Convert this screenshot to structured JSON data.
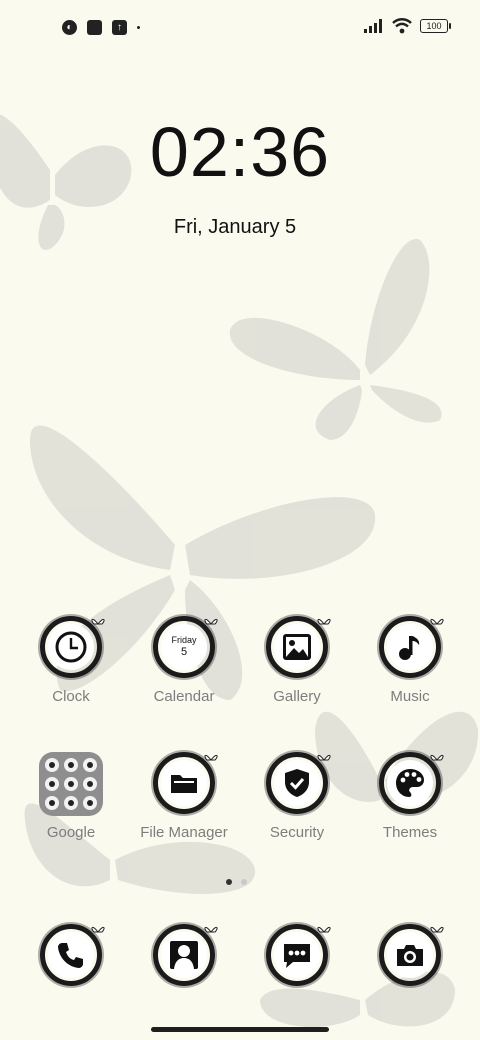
{
  "status_bar": {
    "battery": "100",
    "left_icons": [
      "theme-icon",
      "square-notification-icon",
      "upload-icon",
      "dot-icon"
    ],
    "right_icons": [
      "signal-icon",
      "wifi-icon",
      "battery-icon"
    ]
  },
  "lockscreen": {
    "time": "02:36",
    "date": "Fri, January 5"
  },
  "calendar_icon": {
    "day": "Friday",
    "num": "5"
  },
  "apps": {
    "clock": "Clock",
    "calendar": "Calendar",
    "gallery": "Gallery",
    "music": "Music",
    "google": "Google",
    "file_manager": "File Manager",
    "security": "Security",
    "themes": "Themes"
  },
  "dock_icons": [
    "phone-icon",
    "contacts-icon",
    "messages-icon",
    "camera-icon"
  ],
  "colors": {
    "background": "#fbfaef",
    "icon_ring": "#1b1b1b",
    "label": "#7d7d7d"
  }
}
